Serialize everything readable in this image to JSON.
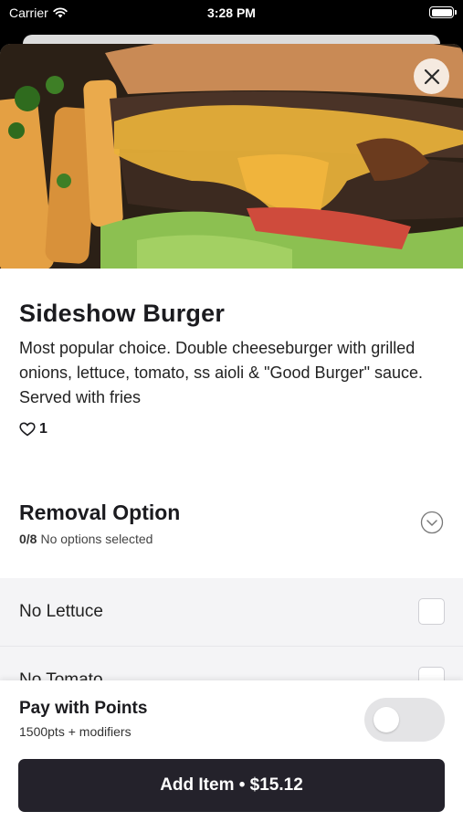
{
  "status_bar": {
    "carrier": "Carrier",
    "time": "3:28 PM"
  },
  "item": {
    "name": "Sideshow Burger",
    "description": "Most popular choice. Double cheeseburger with grilled onions, lettuce, tomato, ss aioli & \"Good Burger\" sauce. Served with fries",
    "likes": "1"
  },
  "modifier_group": {
    "title": "Removal Option",
    "selected_count": "0/8",
    "status_text": "No options selected",
    "options": [
      {
        "label": "No Lettuce",
        "checked": false
      },
      {
        "label": "No Tomato",
        "checked": false
      }
    ]
  },
  "points": {
    "title": "Pay with Points",
    "subtitle": "1500pts + modifiers",
    "enabled": false
  },
  "cta": {
    "label": "Add Item • $15.12"
  },
  "colors": {
    "button": "#24222b",
    "toggle_off": "#e4e4e6"
  }
}
